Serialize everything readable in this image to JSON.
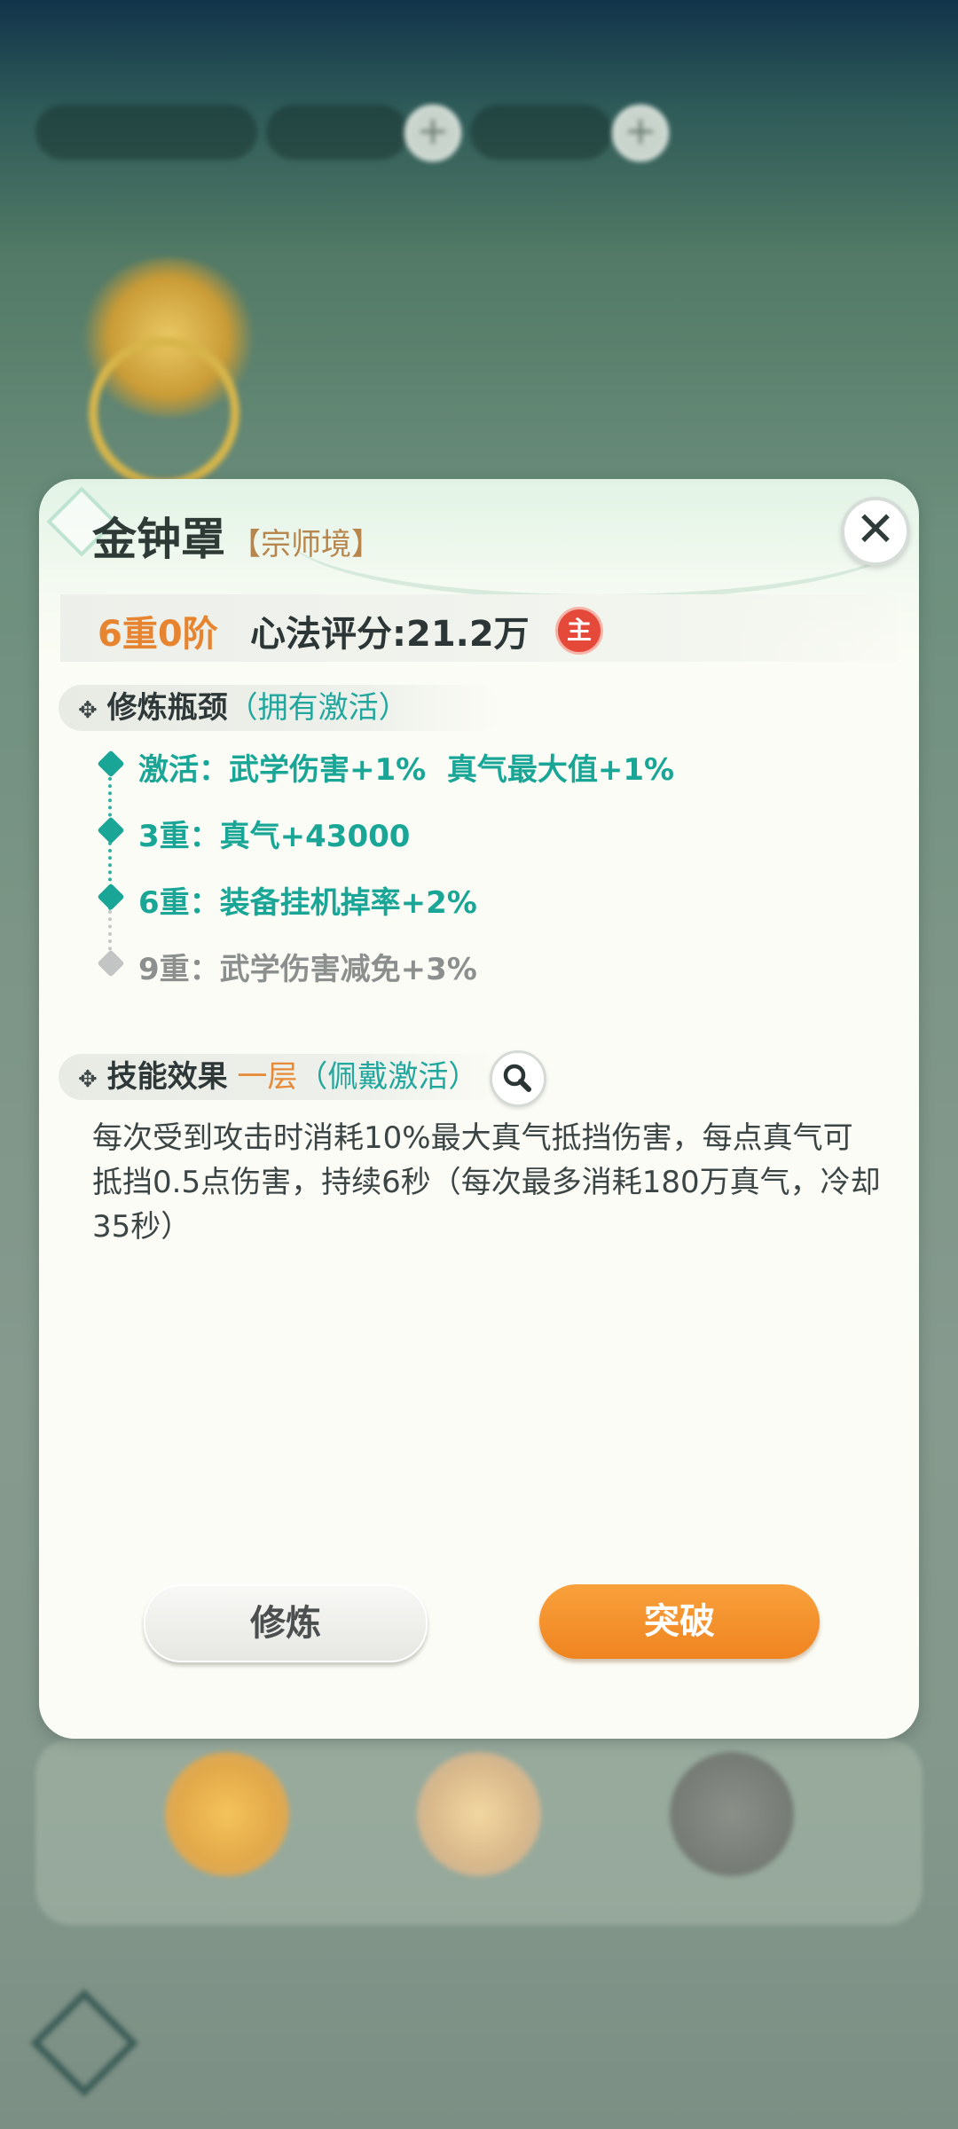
{
  "dialog": {
    "title": "金钟罩",
    "realm": "【宗师境】",
    "close_icon": "close-icon",
    "score": {
      "level": "6重0阶",
      "text": "心法评分:21.2万",
      "badge": "主"
    },
    "bottleneck": {
      "label": "修炼瓶颈",
      "status": "（拥有激活）",
      "items": [
        {
          "text": "激活：武学伤害+1%  真气最大值+1%",
          "active": true
        },
        {
          "text": "3重：真气+43000",
          "active": true
        },
        {
          "text": "6重：装备挂机掉率+2%",
          "active": true
        },
        {
          "text": "9重：武学伤害减免+3%",
          "active": false
        }
      ]
    },
    "skill": {
      "label": "技能效果",
      "layer": "一层",
      "status": "（佩戴激活）",
      "icon": "search-icon",
      "description": "每次受到攻击时消耗10%最大真气抵挡伤害，每点真气可抵挡0.5点伤害，持续6秒（每次最多消耗180万真气，冷却35秒）"
    },
    "buttons": {
      "cultivate": "修炼",
      "breakthrough": "突破"
    }
  },
  "colors": {
    "accent_orange": "#e78430",
    "accent_teal": "#1aa696",
    "badge_red": "#e5493a"
  }
}
